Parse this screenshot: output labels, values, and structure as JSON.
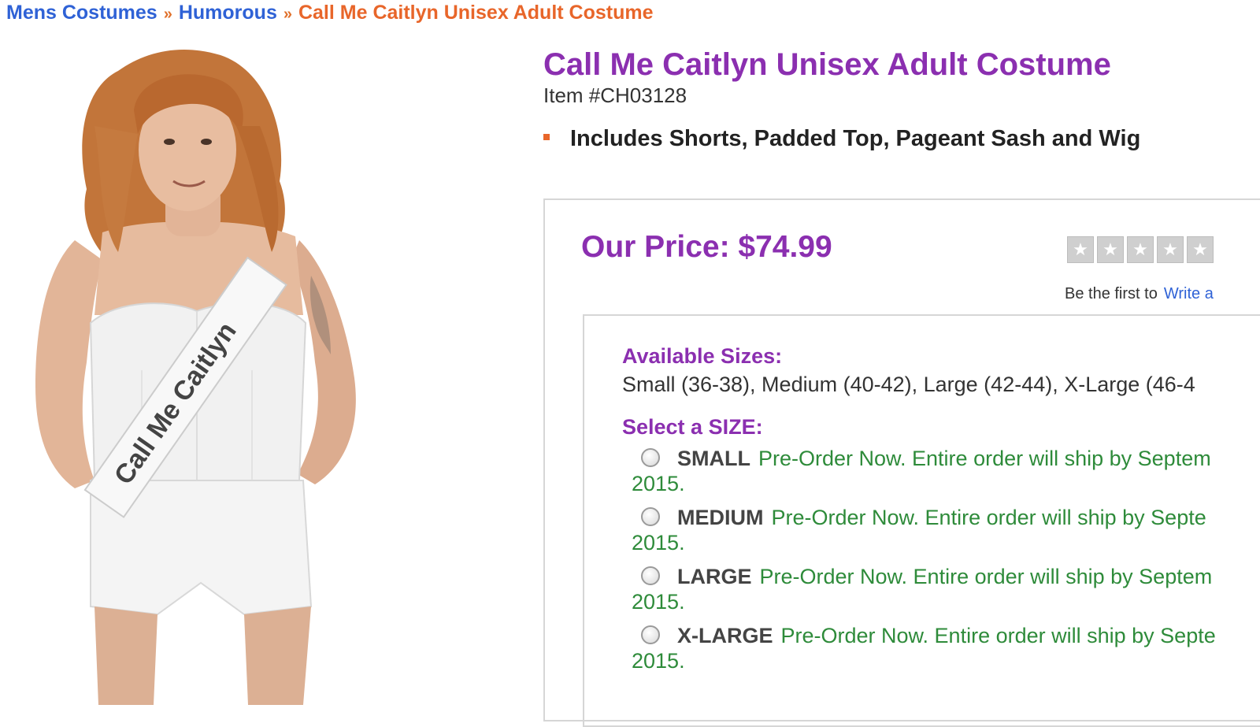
{
  "breadcrumb": {
    "items": [
      "Mens Costumes",
      "Humorous"
    ],
    "separator": "»",
    "current": "Call Me Caitlyn Unisex Adult Costume"
  },
  "product_image": {
    "sash_text": "Call Me Caitlyn"
  },
  "product": {
    "title": "Call Me Caitlyn Unisex Adult Costume",
    "item_number": "Item #CH03128",
    "feature": "Includes Shorts, Padded Top, Pageant Sash and Wig"
  },
  "pricing": {
    "price": "Our Price: $74.99",
    "rating_stars": 0,
    "rating_max": 5,
    "review_prompt": "Be the first to",
    "review_link": "Write a"
  },
  "sizes": {
    "available_label": "Available Sizes:",
    "available_text": "Small (36-38), Medium (40-42), Large (42-44), X-Large (46-4",
    "select_label": "Select a SIZE:",
    "options": [
      {
        "name": "SMALL",
        "message": "Pre-Order Now. Entire order will ship by Septem",
        "year": "2015."
      },
      {
        "name": "MEDIUM",
        "message": "Pre-Order Now. Entire order will ship by Septe",
        "year": "2015."
      },
      {
        "name": "LARGE",
        "message": "Pre-Order Now. Entire order will ship by Septem",
        "year": "2015."
      },
      {
        "name": "X-LARGE",
        "message": "Pre-Order Now. Entire order will ship by Septe",
        "year": "2015."
      }
    ]
  },
  "colors": {
    "title_purple": "#8b2fb0",
    "link_blue": "#2f62d6",
    "breadcrumb_orange": "#e8662a",
    "preorder_green": "#2e8b3a"
  }
}
